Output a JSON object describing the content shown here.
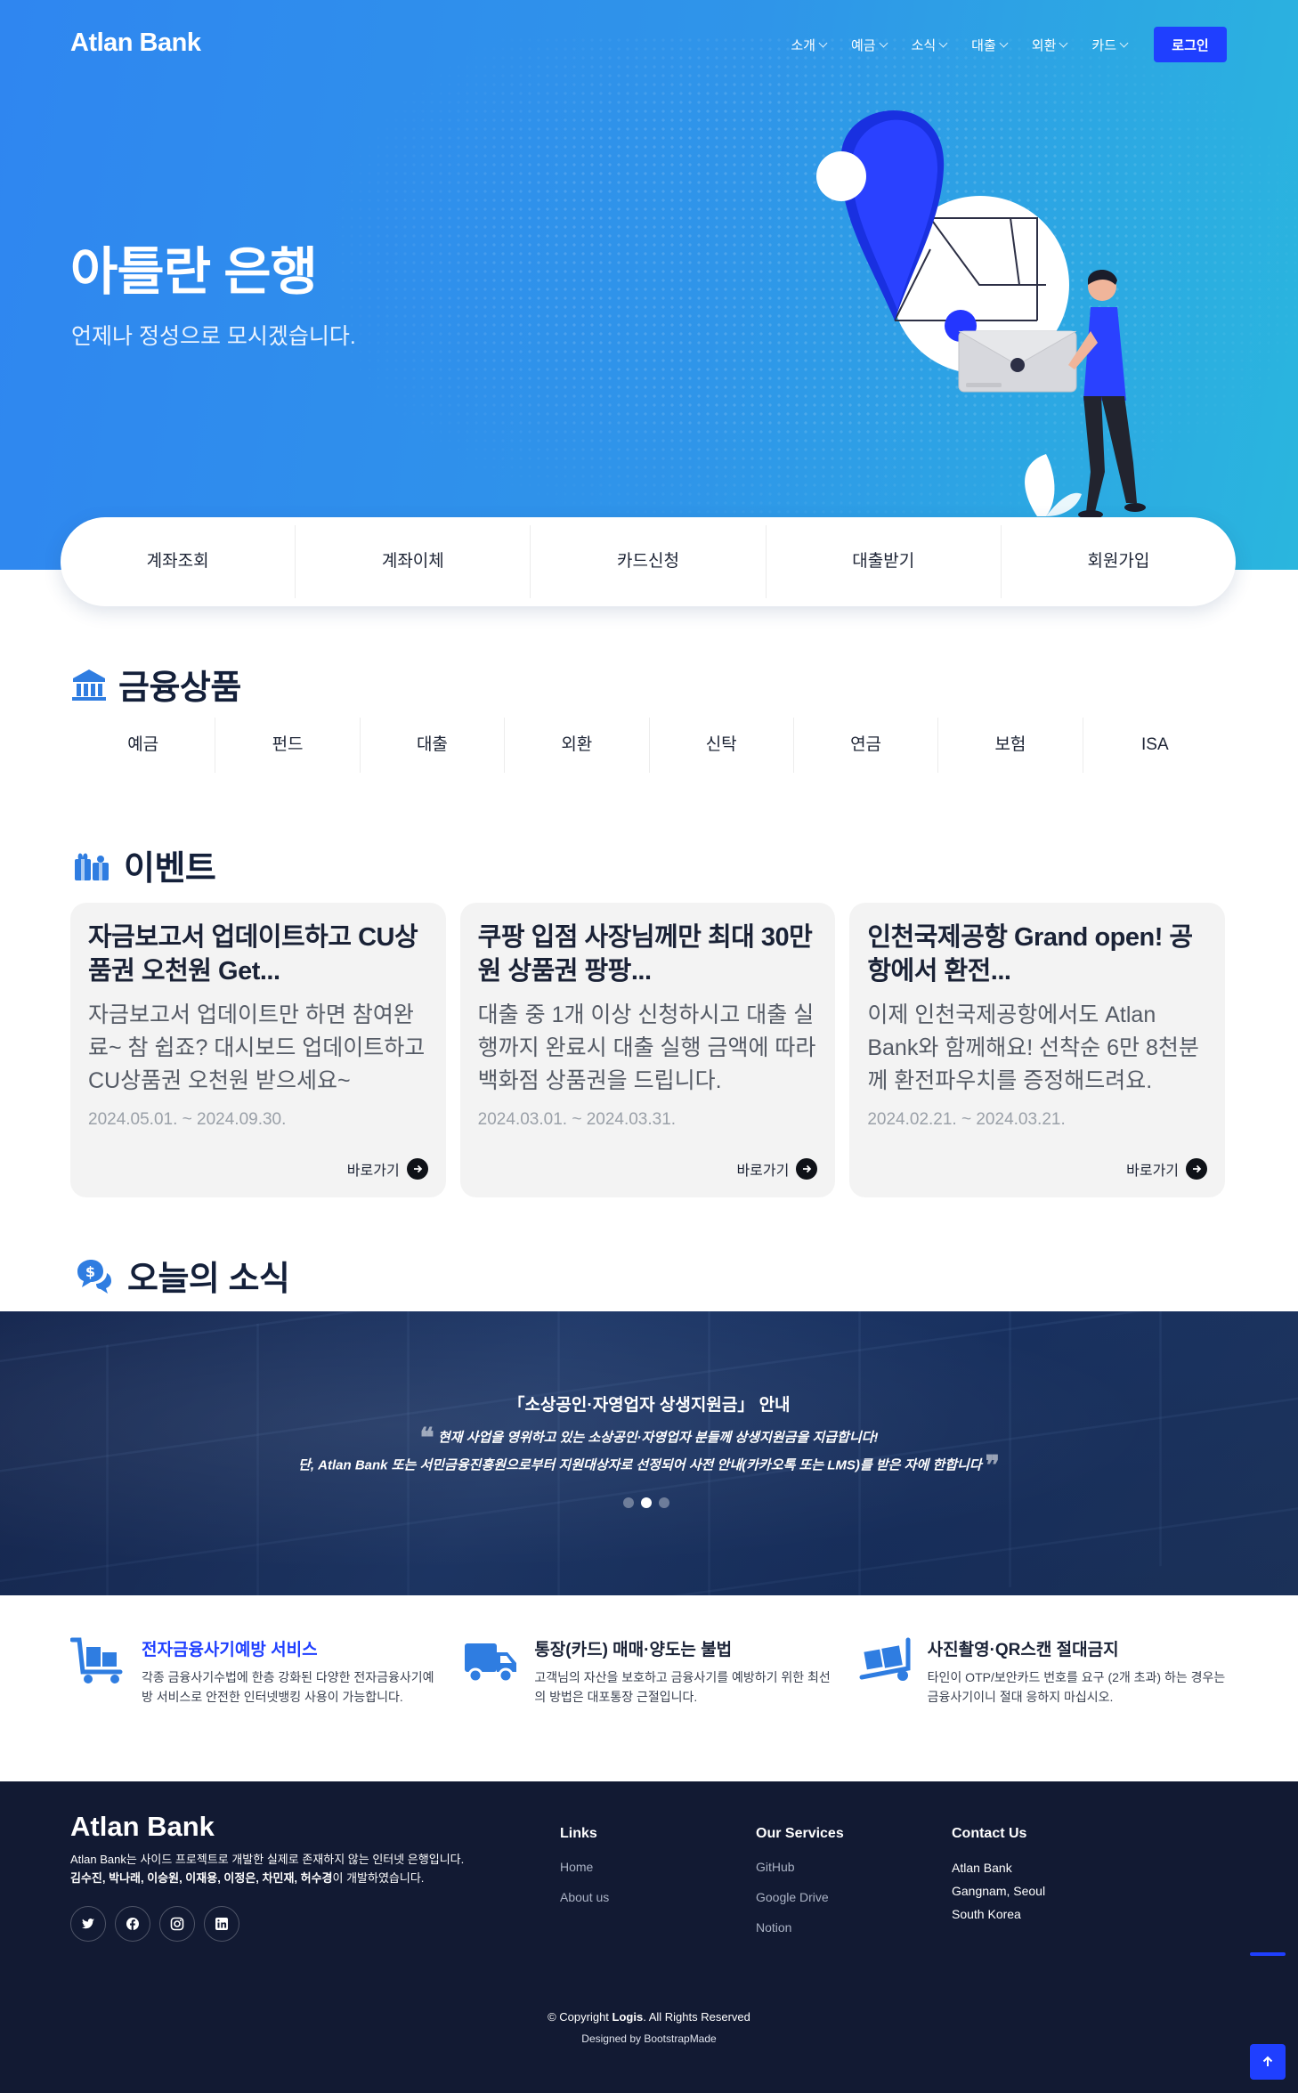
{
  "header": {
    "brand": "Atlan Bank",
    "nav": [
      {
        "label": "소개"
      },
      {
        "label": "예금"
      },
      {
        "label": "소식"
      },
      {
        "label": "대출"
      },
      {
        "label": "외환"
      },
      {
        "label": "카드"
      }
    ],
    "login_label": "로그인"
  },
  "hero": {
    "title": "아틀란 은행",
    "subtitle": "언제나 정성으로 모시겠습니다."
  },
  "quick_menu": [
    "계좌조회",
    "계좌이체",
    "카드신청",
    "대출받기",
    "회원가입"
  ],
  "products": {
    "heading": "금융상품",
    "items": [
      "예금",
      "펀드",
      "대출",
      "외환",
      "신탁",
      "연금",
      "보험",
      "ISA"
    ]
  },
  "events": {
    "heading": "이벤트",
    "items": [
      {
        "title": "자금보고서 업데이트하고 CU상품권 오천원 Get...",
        "desc": "자금보고서 업데이트만 하면 참여완료~ 참 쉽죠? 대시보드 업데이트하고 CU상품권 오천원 받으세요~",
        "date": "2024.05.01. ~ 2024.09.30.",
        "link": "바로가기"
      },
      {
        "title": "쿠팡 입점 사장님께만 최대 30만원 상품권 팡팡...",
        "desc": "대출 중 1개 이상 신청하시고 대출 실행까지 완료시 대출 실행 금액에 따라 백화점 상품권을 드립니다.",
        "date": "2024.03.01. ~ 2024.03.31.",
        "link": "바로가기"
      },
      {
        "title": "인천국제공항 Grand open! 공항에서 환전...",
        "desc": "이제 인천국제공항에서도 Atlan Bank와 함께해요! 선착순 6만 8천분께 환전파우치를 증정해드려요.",
        "date": "2024.02.21. ~ 2024.03.21.",
        "link": "바로가기"
      }
    ]
  },
  "news": {
    "heading": "오늘의 소식",
    "title": "「소상공인·자영업자 상생지원금」 안내",
    "line1": "현재 사업을 영위하고 있는 소상공인·자영업자 분들께 상생지원금을 지급합니다!",
    "line2": "단, Atlan Bank 또는 서민금융진흥원으로부터 지원대상자로 선정되어 사전 안내(카카오톡 또는 LMS)를 받은 자에 한합니다",
    "slides": 3,
    "active_slide": 2
  },
  "notices": [
    {
      "title": "전자금융사기예방 서비스",
      "desc": "각종 금융사기수법에 한층 강화된 다양한 전자금융사기예방 서비스로 안전한 인터넷뱅킹 사용이 가능합니다.",
      "icon": "cart-icon"
    },
    {
      "title": "통장(카드) 매매·양도는 불법",
      "desc": "고객님의 자산을 보호하고 금융사기를 예방하기 위한 최선의 방법은 대포통장 근절입니다.",
      "icon": "truck-icon"
    },
    {
      "title": "사진촬영·QR스캔 절대금지",
      "desc": "타인이 OTP/보안카드 번호를 요구 (2개 초과) 하는 경우는 금융사기이니 절대 응하지 마십시오.",
      "icon": "dolly-icon"
    }
  ],
  "footer": {
    "brand": "Atlan Bank",
    "desc_line1": "Atlan Bank는 사이드 프로젝트로 개발한 실제로 존재하지 않는 인터넷 은행입니다.",
    "desc_names": "김수진, 박나래, 이승원, 이재용, 이정은, 차민재, 허수경",
    "desc_suffix": "이 개발하였습니다.",
    "socials": [
      "twitter-icon",
      "facebook-icon",
      "instagram-icon",
      "linkedin-icon"
    ],
    "links": {
      "heading": "Links",
      "items": [
        "Home",
        "About us"
      ]
    },
    "services": {
      "heading": "Our Services",
      "items": [
        "GitHub",
        "Google Drive",
        "Notion"
      ]
    },
    "contact": {
      "heading": "Contact Us",
      "lines": [
        "Atlan Bank",
        "Gangnam, Seoul",
        "South Korea"
      ]
    },
    "copyright_prefix": "© Copyright",
    "copyright_brand": "Logis",
    "copyright_suffix": ". All Rights Reserved",
    "designed": "Designed by BootstrapMade"
  },
  "colors": {
    "accent": "#1f3fff",
    "hero_start": "#2f86f0",
    "hero_end": "#2ab6de",
    "icon_blue": "#2f7de1",
    "footer_bg": "#121a33"
  }
}
